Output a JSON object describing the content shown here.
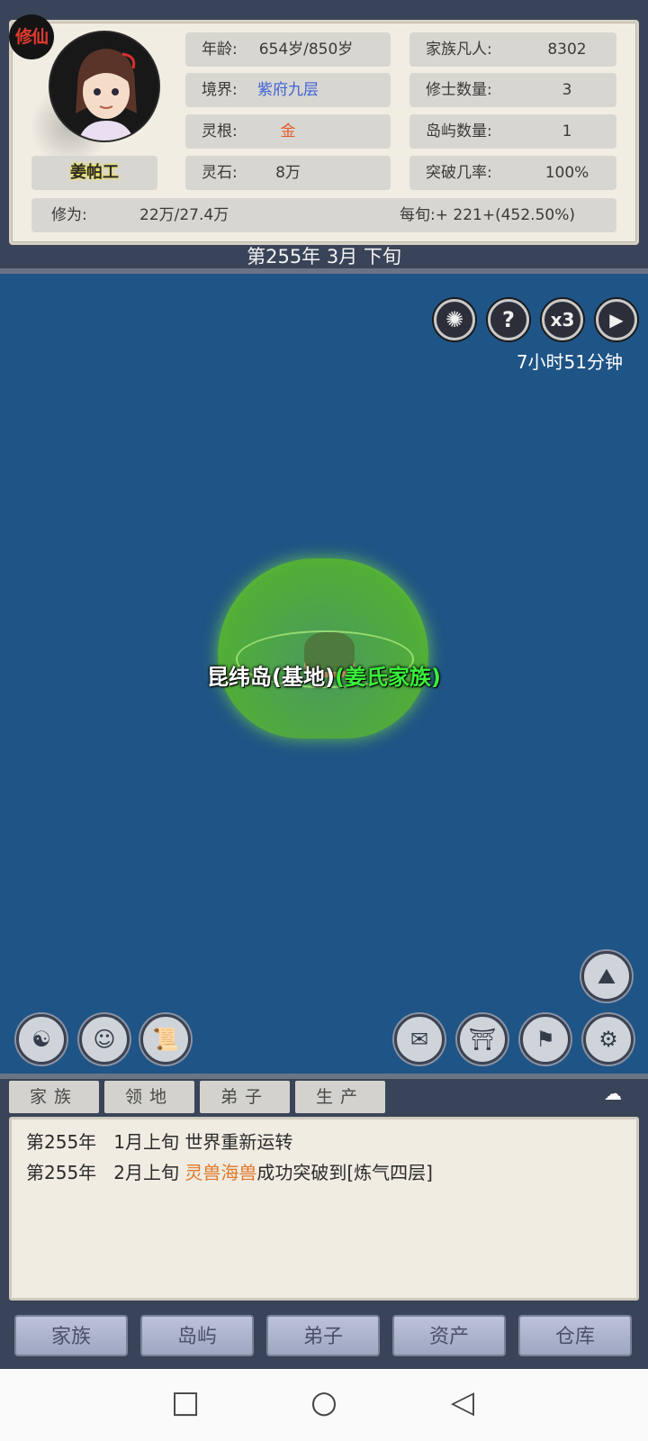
{
  "header": {
    "badge": "修仙",
    "player_name": "姜帕工",
    "age_label": "年龄:",
    "age_value": "654岁/850岁",
    "realm_label": "境界:",
    "realm_value": "紫府九层",
    "root_label": "灵根:",
    "root_value": "金",
    "stones_label": "灵石:",
    "stones_value": "8万",
    "mortals_label": "家族凡人:",
    "mortals_value": "8302",
    "cultivators_label": "修士数量:",
    "cultivators_value": "3",
    "islands_label": "岛屿数量:",
    "islands_value": "1",
    "breakthrough_label": "突破几率:",
    "breakthrough_value": "100%",
    "cultivation_label": "修为:",
    "cultivation_value": "22万/27.4万",
    "per_period": "每旬:+ 221+(452.50%)"
  },
  "date": "第255年 3月 下旬",
  "map": {
    "timer": "7小时51分钟",
    "speed_label": "x3",
    "island_name": "昆纬岛(基地)",
    "island_clan": "(姜氏家族)"
  },
  "log": {
    "tabs": [
      "家族",
      "领地",
      "弟子",
      "生产"
    ],
    "lines": [
      {
        "year": "第255年",
        "period": "1月上旬",
        "text": "世界重新运转"
      },
      {
        "year": "第255年",
        "period": "2月上旬",
        "beast": "灵兽海兽",
        "text": "成功突破到[炼气四层]"
      }
    ]
  },
  "nav": [
    "家族",
    "岛屿",
    "弟子",
    "资产",
    "仓库"
  ],
  "colors": {
    "sea": "#1f5486",
    "frame": "#3a4458",
    "realm_text": "#3d63d8",
    "root_text": "#e25c2e",
    "clan_text": "#39ef3a",
    "beast_text": "#e0792c"
  }
}
